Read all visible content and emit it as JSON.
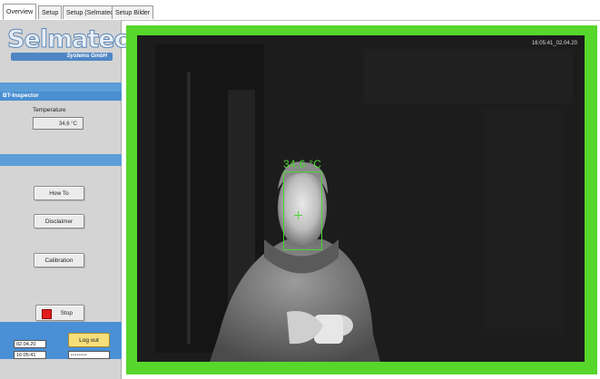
{
  "tabs": [
    "Overview",
    "Setup",
    "Setup (Selmatec)",
    "Setup Bilder"
  ],
  "logo": {
    "name": "Selmatec",
    "subtitle": "Systems GmbH"
  },
  "panel_title": "BT-Inspector",
  "temperature": {
    "label": "Temperature",
    "value": "34,6 °C"
  },
  "buttons": {
    "howto": "How To",
    "disclaimer": "Disclaimer",
    "calibration": "Calibration",
    "stop": "Stop",
    "logout": "Log out"
  },
  "datetime": {
    "date": "02.04.20",
    "time": "16:05:41"
  },
  "password_mask": "••••••••",
  "camera": {
    "timestamp": "16:05:41_02.04.20",
    "overlay_temperature": "34,6 °C"
  },
  "colors": {
    "frame": "#57d62b",
    "accent": "#4a90d6",
    "overlay": "#4fd433",
    "stop": "#e11d1d",
    "logout": "#f6df7a"
  }
}
